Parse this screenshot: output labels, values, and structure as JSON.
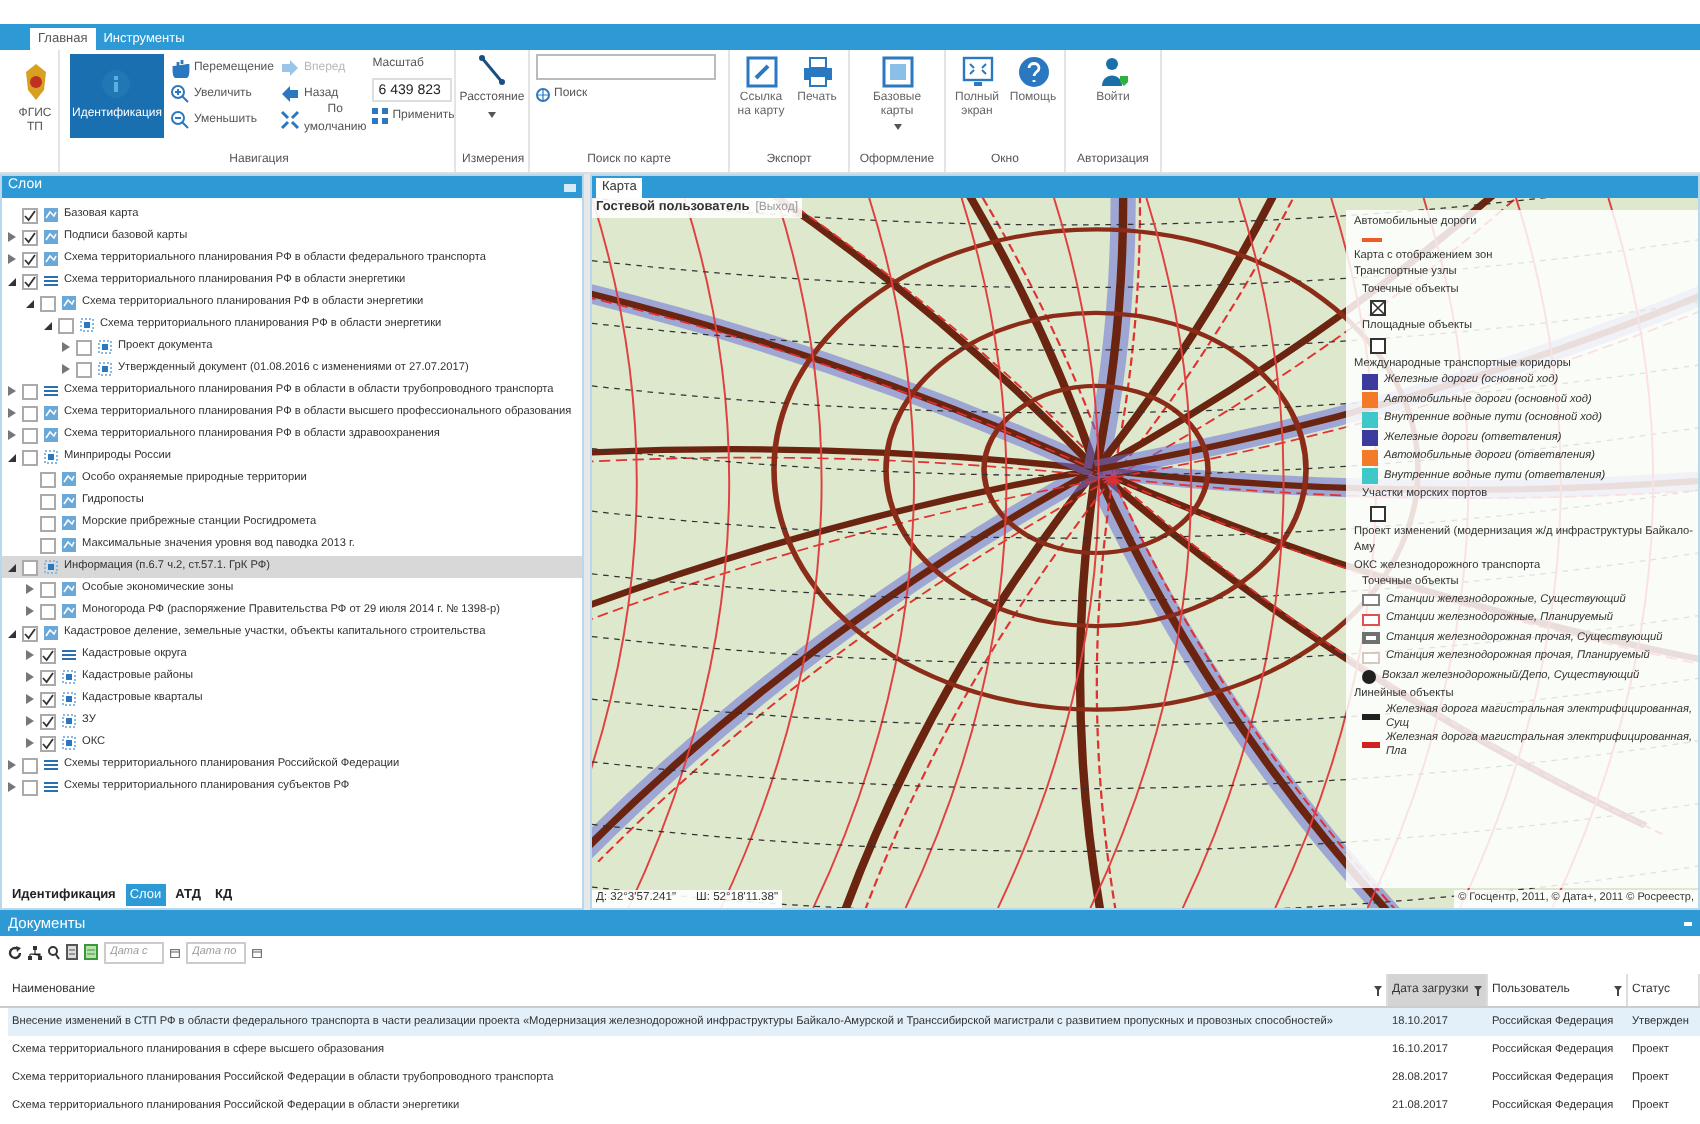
{
  "ribbon_tabs": [
    {
      "label": "Главная",
      "selected": true
    },
    {
      "label": "Инструменты",
      "selected": false
    }
  ],
  "ribbon": {
    "logo_text": "ФГИС ТП",
    "navigation": {
      "group": "Навигация",
      "identify": {
        "label": "Идентификация",
        "selected": true
      },
      "buttons": [
        {
          "label": "Перемещение",
          "disabled": false
        },
        {
          "label": "Увеличить",
          "disabled": false
        },
        {
          "label": "Уменьшить",
          "disabled": false
        },
        {
          "label": "Вперед",
          "disabled": true
        },
        {
          "label": "Назад",
          "disabled": false
        },
        {
          "label": "По умолчанию",
          "disabled": false
        }
      ],
      "scale_label": "Масштаб",
      "scale_value": "6 439 823",
      "apply": "Применить"
    },
    "measure": {
      "group": "Измерения",
      "button": "Расстояние"
    },
    "search": {
      "group": "Поиск по карте",
      "button": "Поиск"
    },
    "groups": [
      {
        "name": "Экспорт",
        "buttons": [
          {
            "label": "Ссылка на карту"
          },
          {
            "label": "Печать"
          }
        ]
      },
      {
        "name": "Оформление",
        "buttons": [
          {
            "label": "Базовые карты",
            "dropdown": true
          }
        ]
      },
      {
        "name": "Окно",
        "buttons": [
          {
            "label": "Полный экран"
          },
          {
            "label": "Помощь"
          }
        ]
      },
      {
        "name": "Авторизация",
        "buttons": [
          {
            "label": "Войти"
          }
        ]
      }
    ]
  },
  "layers_panel": {
    "title": "Слои",
    "items": [
      {
        "label": "Базовая карта",
        "checked": true,
        "kind": "map",
        "selected": false
      },
      {
        "label": "Подписи базовой карты",
        "checked": true,
        "kind": "map",
        "expanded": false,
        "selected": false
      },
      {
        "label": "Схема территориального планирования РФ в области федерального транспорта",
        "checked": true,
        "kind": "map",
        "expanded": false,
        "selected": false
      },
      {
        "label": "Схема территориального планирования РФ в области энергетики",
        "checked": true,
        "kind": "list",
        "expanded": true,
        "selected": false,
        "children": [
          {
            "label": "Схема территориального планирования РФ в области энергетики",
            "checked": false,
            "kind": "map",
            "expanded": true,
            "selected": false,
            "children": [
              {
                "label": "Схема территориального планирования РФ в области энергетики",
                "checked": false,
                "kind": "square",
                "expanded": true,
                "selected": false,
                "children": [
                  {
                    "label": "Проект документа",
                    "checked": false,
                    "kind": "square",
                    "expanded": false,
                    "selected": false
                  },
                  {
                    "label": "Утвержденный документ (01.08.2016 с изменениями от 27.07.2017)",
                    "checked": false,
                    "kind": "square",
                    "expanded": false,
                    "selected": false
                  }
                ]
              }
            ]
          }
        ]
      },
      {
        "label": "Схема территориального планирования РФ в области в области трубопроводного транспорта",
        "checked": false,
        "kind": "list",
        "expanded": false,
        "selected": false
      },
      {
        "label": "Схема территориального планирования РФ в области высшего профессионального образования",
        "checked": false,
        "kind": "map",
        "expanded": false,
        "selected": false
      },
      {
        "label": "Схема территориального планирования РФ в области здравоохранения",
        "checked": false,
        "kind": "map",
        "expanded": false,
        "selected": false
      },
      {
        "label": "Минприроды России",
        "checked": false,
        "kind": "square",
        "expanded": true,
        "selected": false,
        "children": [
          {
            "label": "Особо охраняемые природные территории",
            "checked": false,
            "kind": "map",
            "selected": false
          },
          {
            "label": "Гидропосты",
            "checked": false,
            "kind": "map",
            "selected": false
          },
          {
            "label": "Морские прибрежные станции Росгидромета",
            "checked": false,
            "kind": "map",
            "selected": false
          },
          {
            "label": "Максимальные значения уровня вод паводка 2013 г.",
            "checked": false,
            "kind": "map",
            "selected": false
          }
        ]
      },
      {
        "label": "Информация (п.6.7 ч.2, ст.57.1. ГрК РФ)",
        "checked": false,
        "kind": "square",
        "expanded": true,
        "selected": true,
        "children": [
          {
            "label": "Особые экономические зоны",
            "checked": false,
            "kind": "map",
            "expanded": false,
            "selected": false
          },
          {
            "label": "Моногорода РФ (распоряжение Правительства РФ от 29 июля 2014 г. № 1398-р)",
            "checked": false,
            "kind": "map",
            "expanded": false,
            "selected": false
          }
        ]
      },
      {
        "label": "Кадастровое деление, земельные участки, объекты капитального строительства",
        "checked": true,
        "kind": "map",
        "expanded": true,
        "selected": false,
        "children": [
          {
            "label": "Кадастровые округа",
            "checked": true,
            "kind": "list",
            "expanded": false,
            "selected": false
          },
          {
            "label": "Кадастровые районы",
            "checked": true,
            "kind": "square",
            "expanded": false,
            "selected": false
          },
          {
            "label": "Кадастровые кварталы",
            "checked": true,
            "kind": "square",
            "expanded": false,
            "selected": false
          },
          {
            "label": "ЗУ",
            "checked": true,
            "kind": "square",
            "expanded": false,
            "selected": false
          },
          {
            "label": "ОКС",
            "checked": true,
            "kind": "square",
            "expanded": false,
            "selected": false
          }
        ]
      },
      {
        "label": "Схемы территориального планирования Российской Федерации",
        "checked": false,
        "kind": "list",
        "expanded": false,
        "selected": false
      },
      {
        "label": "Схемы территориального планирования субъектов РФ",
        "checked": false,
        "kind": "list",
        "expanded": false,
        "selected": false
      }
    ],
    "tabs": [
      {
        "label": "Идентификация",
        "selected": false
      },
      {
        "label": "Слои",
        "selected": true
      },
      {
        "label": "АТД",
        "selected": false
      },
      {
        "label": "КД",
        "selected": false
      }
    ]
  },
  "map_panel": {
    "tab": {
      "label": "Карта",
      "selected": true
    },
    "user": "Гостевой пользователь",
    "logout": "[Выход]",
    "coord_lon": "Д: 32°3'57.241\"",
    "coord_lat": "Ш: 52°18'11.38\"",
    "copyright": "© Госцентр, 2011, © Дата+, 2011 © Росреестр,",
    "legend": [
      {
        "kind": "title",
        "label": "Автомобильные дороги"
      },
      {
        "kind": "line",
        "color": "#f05a28"
      },
      {
        "kind": "title",
        "label": "Карта с отображением зон"
      },
      {
        "kind": "title",
        "label": "Транспортные узлы"
      },
      {
        "kind": "subtitle",
        "label": "Точечные объекты"
      },
      {
        "kind": "crossbox"
      },
      {
        "kind": "subtitle",
        "label": "Площадные объекты"
      },
      {
        "kind": "box"
      },
      {
        "kind": "title",
        "label": "Международные транспортные коридоры"
      },
      {
        "kind": "swatch",
        "color": "#3d3a9e",
        "label": "Железные дороги (основной ход)"
      },
      {
        "kind": "swatch",
        "color": "#f47a2a",
        "label": "Автомобильные дороги (основной ход)"
      },
      {
        "kind": "swatch",
        "color": "#3ec8c8",
        "label": "Внутренние водные пути (основной ход)"
      },
      {
        "kind": "swatch",
        "color": "#3d3a9e",
        "label": "Железные дороги (ответвления)"
      },
      {
        "kind": "swatch",
        "color": "#f47a2a",
        "label": "Автомобильные дороги (ответвления)"
      },
      {
        "kind": "swatch",
        "color": "#3ec8c8",
        "label": "Внутренние водные пути (ответвления)"
      },
      {
        "kind": "subtitle",
        "label": "Участки морских портов"
      },
      {
        "kind": "box"
      },
      {
        "kind": "title",
        "label": "Проект изменений (модернизация ж/д инфраструктуры Байкало-Аму"
      },
      {
        "kind": "title",
        "label": "ОКС железнодорожного транспорта"
      },
      {
        "kind": "subtitle",
        "label": "Точечные объекты"
      },
      {
        "kind": "outline",
        "color": "#808080",
        "label": "Станции железнодорожные, Существующий"
      },
      {
        "kind": "outline",
        "color": "#e05050",
        "label": "Станции железнодорожные, Планируемый"
      },
      {
        "kind": "thick",
        "color": "#707070",
        "label": "Станция железнодорожная прочая, Существующий"
      },
      {
        "kind": "outline",
        "color": "#d8c8c0",
        "label": "Станция железнодорожная прочая, Планируемый"
      },
      {
        "kind": "station",
        "color": "#202020",
        "label": "Вокзал железнодорожный/Депо, Существующий"
      },
      {
        "kind": "title",
        "label": "Линейные объекты"
      },
      {
        "kind": "rail",
        "color": "#202020",
        "label": "Железная дорога магистральная электрифицированная, Сущ"
      },
      {
        "kind": "rail",
        "color": "#d02020",
        "label": "Железная дорога магистральная электрифицированная, Пла"
      }
    ]
  },
  "documents": {
    "title": "Документы",
    "date_from": {
      "placeholder": "Дата с"
    },
    "date_to": {
      "placeholder": "Дата по"
    },
    "columns": [
      {
        "label": "Наименование",
        "sorted": false
      },
      {
        "label": "Дата загрузки",
        "sorted": true
      },
      {
        "label": "Пользователь",
        "sorted": false
      },
      {
        "label": "Статус",
        "sorted": false
      }
    ],
    "rows": [
      {
        "cells": [
          "Внесение изменений в СТП РФ в области федерального транспорта  в части реализации проекта «Модернизация железнодорожной инфраструктуры Байкало-Амурской и Транссибирской магистрали с развитием пропускных и провозных способностей»",
          "18.10.2017",
          "Российская Федерация",
          "Утвержден"
        ],
        "selected": true
      },
      {
        "cells": [
          "Схема территориального планирования в сфере высшего образования",
          "16.10.2017",
          "Российская Федерация",
          "Проект"
        ],
        "selected": false
      },
      {
        "cells": [
          "Схема территориального планирования Российской Федерации в области трубопроводного транспорта",
          "28.08.2017",
          "Российская Федерация",
          "Проект"
        ],
        "selected": false
      },
      {
        "cells": [
          "Схема территориального планирования Российской Федерации в области энергетики",
          "21.08.2017",
          "Российская Федерация",
          "Проект"
        ],
        "selected": false
      }
    ]
  }
}
